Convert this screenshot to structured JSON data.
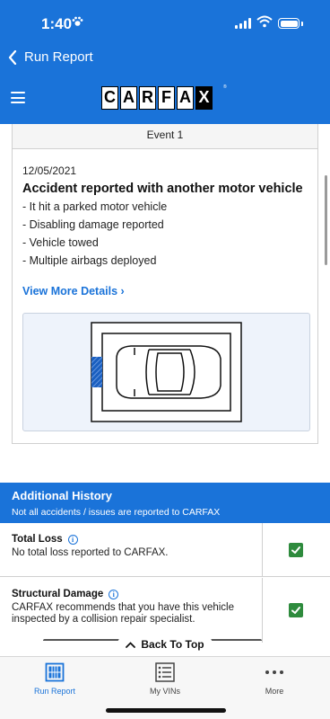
{
  "status_bar": {
    "time": "1:40",
    "pet_icon": "paw-icon"
  },
  "nav": {
    "back_label": "Run Report"
  },
  "header": {
    "logo_letters": [
      "C",
      "A",
      "R",
      "F",
      "A",
      "X"
    ],
    "reg_mark": "®"
  },
  "event": {
    "header": "Event 1",
    "date": "12/05/2021",
    "title": "Accident reported with another motor vehicle",
    "details": [
      "- It hit a parked motor vehicle",
      "- Disabling damage reported",
      "- Vehicle towed",
      "- Multiple airbags deployed"
    ],
    "view_more": "View More Details ›"
  },
  "additional_history": {
    "title": "Additional History",
    "subtitle": "Not all accidents / issues are reported to CARFAX",
    "rows": [
      {
        "label": "Total Loss",
        "desc": "No total loss reported to CARFAX."
      },
      {
        "label": "Structural Damage",
        "desc": "CARFAX recommends that you have this vehicle inspected by a collision repair specialist."
      }
    ]
  },
  "back_to_top": "Back To Top",
  "tabs": [
    {
      "label": "Run Report",
      "icon": "report-icon",
      "active": true
    },
    {
      "label": "My VINs",
      "icon": "list-icon",
      "active": false
    },
    {
      "label": "More",
      "icon": "more-dots-icon",
      "active": false
    }
  ],
  "colors": {
    "brand_blue": "#1a73d9",
    "check_green": "#2e8b3d",
    "damage_blue": "#1a5fc0"
  }
}
